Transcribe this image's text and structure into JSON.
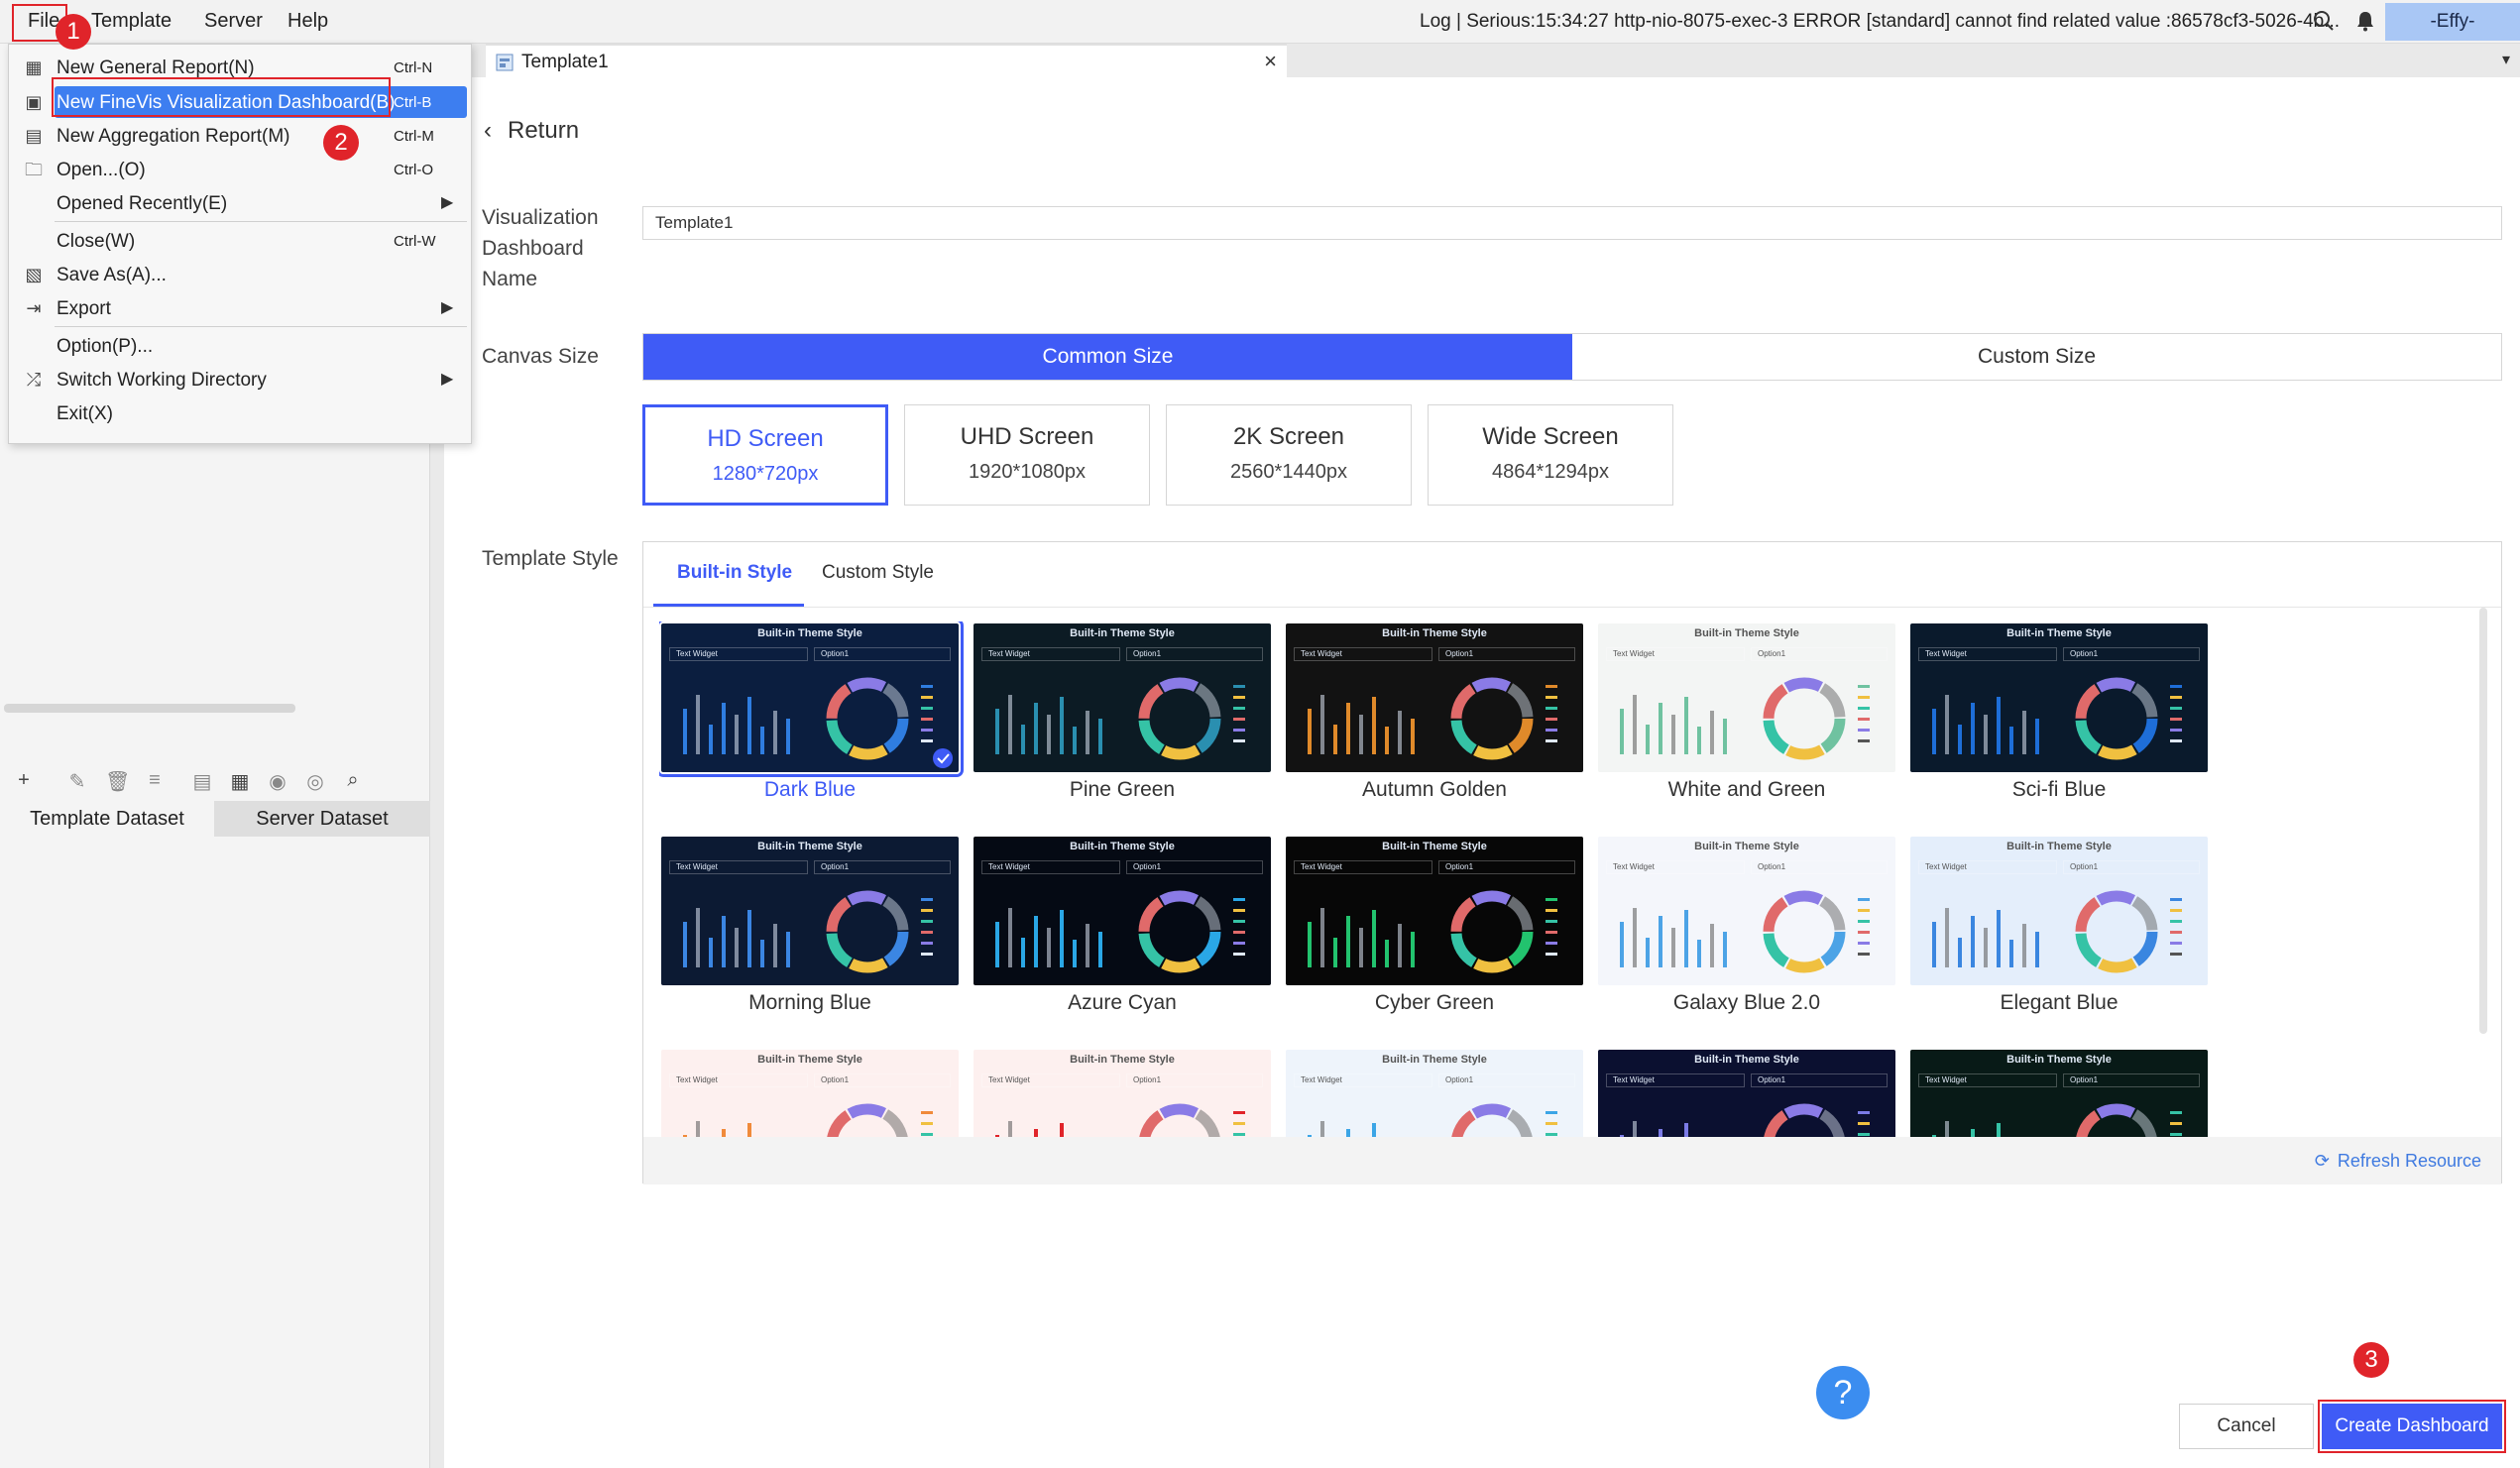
{
  "menubar": {
    "items": [
      "File",
      "Template",
      "Server",
      "Help"
    ],
    "log": "Log | Serious:15:34:27 http-nio-8075-exec-3 ERROR [standard] cannot find related value :86578cf3-5026-4b...",
    "user": "-Effy-"
  },
  "file_menu": {
    "items": [
      {
        "label": "New General Report(N)",
        "shortcut": "Ctrl-N",
        "icon": "grid-report-icon"
      },
      {
        "label": "New FineVis Visualization Dashboard(B)",
        "shortcut": "Ctrl-B",
        "icon": "dashboard-icon"
      },
      {
        "label": "New Aggregation Report(M)",
        "shortcut": "Ctrl-M",
        "icon": "aggregation-icon"
      },
      {
        "label": "Open...(O)",
        "shortcut": "Ctrl-O",
        "icon": "folder-open-icon"
      },
      {
        "label": "Opened Recently(E)",
        "shortcut": "",
        "icon": ""
      },
      {
        "label": "Close(W)",
        "shortcut": "Ctrl-W",
        "icon": ""
      },
      {
        "label": "Save As(A)...",
        "shortcut": "",
        "icon": "save-as-icon"
      },
      {
        "label": "Export",
        "shortcut": "",
        "icon": "export-icon"
      },
      {
        "label": "Option(P)...",
        "shortcut": "",
        "icon": ""
      },
      {
        "label": "Switch Working Directory",
        "shortcut": "",
        "icon": "shuffle-icon"
      },
      {
        "label": "Exit(X)",
        "shortcut": "",
        "icon": ""
      }
    ]
  },
  "annotations": [
    "1",
    "2",
    "3"
  ],
  "left_panel": {
    "tabs": [
      "Template Dataset",
      "Server Dataset"
    ]
  },
  "editor_tab": {
    "label": "Template1"
  },
  "form": {
    "return_label": "Return",
    "name_label": "Visualization Dashboard Name",
    "name_value": "Template1",
    "canvas_label": "Canvas Size",
    "size_options": [
      "Common Size",
      "Custom Size"
    ],
    "screens": [
      {
        "name": "HD Screen",
        "res": "1280*720px"
      },
      {
        "name": "UHD Screen",
        "res": "1920*1080px"
      },
      {
        "name": "2K Screen",
        "res": "2560*1440px"
      },
      {
        "name": "Wide Screen",
        "res": "4864*1294px"
      }
    ],
    "style_label": "Template Style",
    "style_tabs": [
      "Built-in Style",
      "Custom Style"
    ],
    "thumb_title": "Built-in Theme Style",
    "thumb_widget": "Text Widget",
    "thumb_option": "Option1",
    "themes": [
      {
        "name": "Dark Blue",
        "bg": "#0b1e3f",
        "accent": "#2f7de0"
      },
      {
        "name": "Pine Green",
        "bg": "#0c1b24",
        "accent": "#2a8fb0"
      },
      {
        "name": "Autumn Golden",
        "bg": "#121212",
        "accent": "#e08a2a"
      },
      {
        "name": "White and Green",
        "bg": "#f3f5f4",
        "accent": "#6fc2a0"
      },
      {
        "name": "Sci-fi Blue",
        "bg": "#0a1a2c",
        "accent": "#1e6ed8"
      },
      {
        "name": "Morning Blue",
        "bg": "#0c1a33",
        "accent": "#3b86e3"
      },
      {
        "name": "Azure Cyan",
        "bg": "#050a14",
        "accent": "#2aa7e6"
      },
      {
        "name": "Cyber Green",
        "bg": "#070707",
        "accent": "#22c36e"
      },
      {
        "name": "Galaxy Blue 2.0",
        "bg": "#f4f6fb",
        "accent": "#4ca3e6"
      },
      {
        "name": "Elegant Blue",
        "bg": "#e4eefb",
        "accent": "#3a86e0"
      },
      {
        "name": "",
        "bg": "#fdf0ef",
        "accent": "#f08a3a"
      },
      {
        "name": "",
        "bg": "#fdf0ef",
        "accent": "#e0242a"
      },
      {
        "name": "",
        "bg": "#eef4fb",
        "accent": "#3ba5e6"
      },
      {
        "name": "",
        "bg": "#0b1030",
        "accent": "#7b7be6"
      },
      {
        "name": "",
        "bg": "#081a17",
        "accent": "#35c3a6"
      }
    ],
    "refresh_label": "Refresh Resource",
    "help_label": "?",
    "cancel_label": "Cancel",
    "create_label": "Create Dashboard"
  }
}
